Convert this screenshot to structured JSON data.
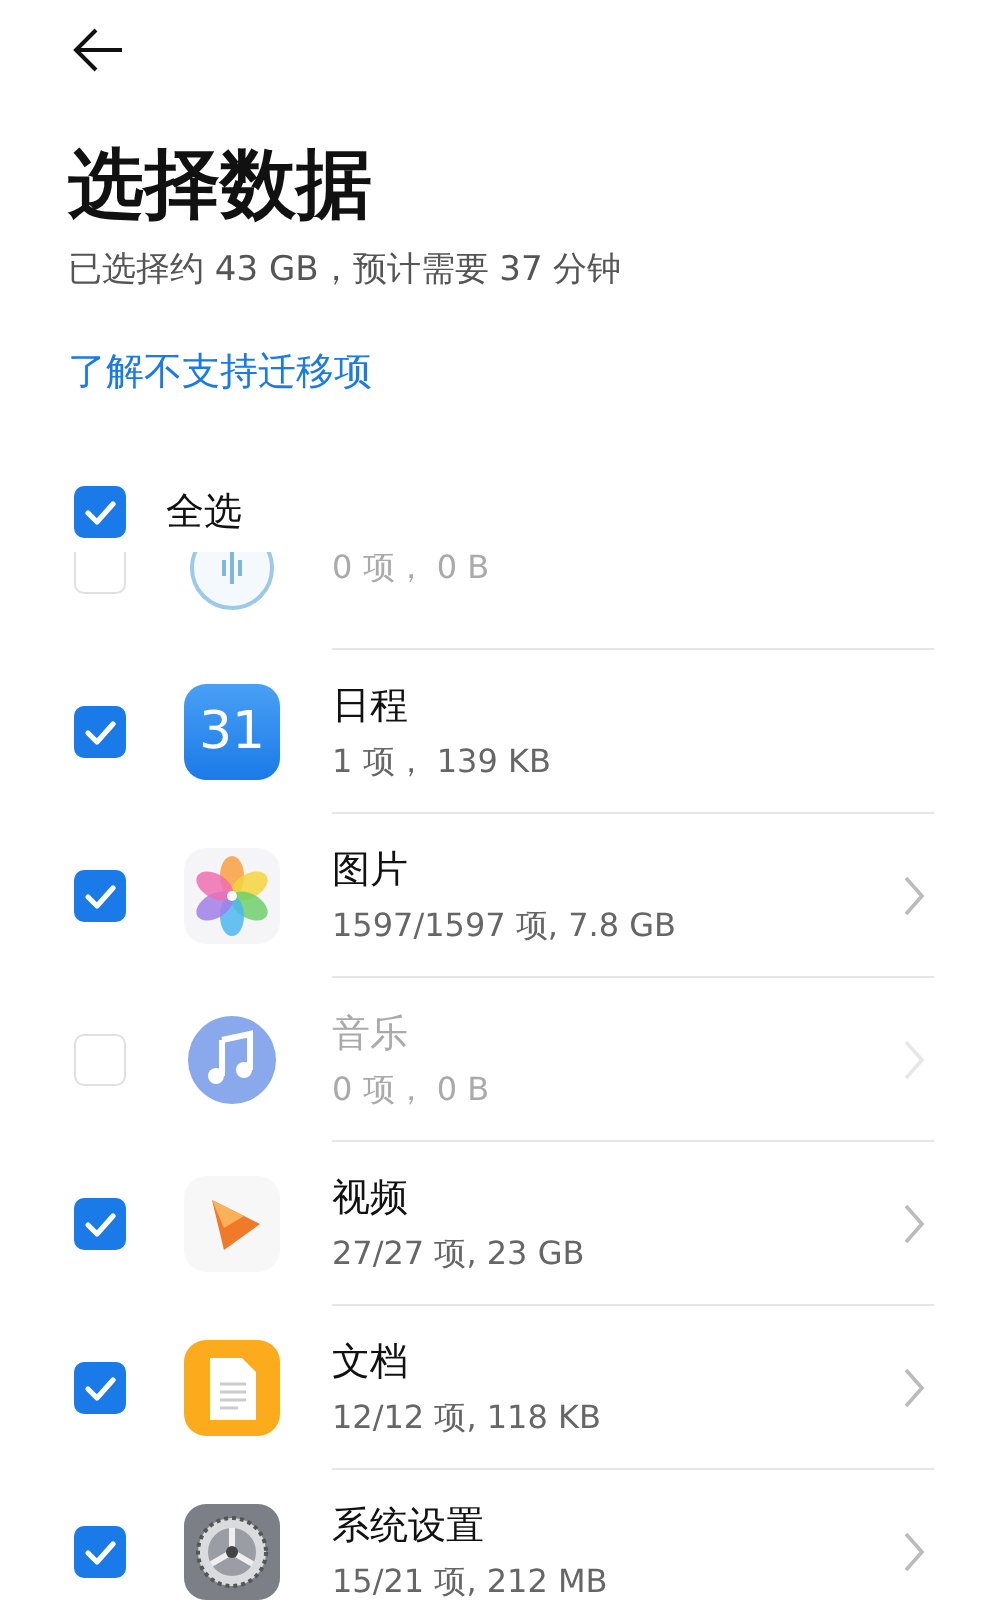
{
  "header": {
    "title": "选择数据",
    "summary": "已选择约 43 GB，预计需要 37 分钟",
    "link": "了解不支持迁移项"
  },
  "select_all": {
    "label": "全选",
    "checked": true
  },
  "items": [
    {
      "kind": "recorder",
      "detail": "0 项， 0 B",
      "checked": false,
      "disabled": true,
      "expandable": false
    },
    {
      "kind": "calendar",
      "icon_text": "31",
      "name": "日程",
      "detail": "1 项， 139 KB",
      "checked": true,
      "disabled": false,
      "expandable": false
    },
    {
      "kind": "gallery",
      "name": "图片",
      "detail": "1597/1597 项, 7.8 GB",
      "checked": true,
      "disabled": false,
      "expandable": true
    },
    {
      "kind": "music",
      "name": "音乐",
      "detail": "0 项， 0 B",
      "checked": false,
      "disabled": true,
      "expandable": true
    },
    {
      "kind": "video",
      "name": "视频",
      "detail": "27/27 项, 23 GB",
      "checked": true,
      "disabled": false,
      "expandable": true
    },
    {
      "kind": "document",
      "name": "文档",
      "detail": "12/12 项, 118 KB",
      "checked": true,
      "disabled": false,
      "expandable": true
    },
    {
      "kind": "settings",
      "name": "系统设置",
      "detail": "15/21 项, 212 MB",
      "checked": true,
      "disabled": false,
      "expandable": true
    }
  ]
}
